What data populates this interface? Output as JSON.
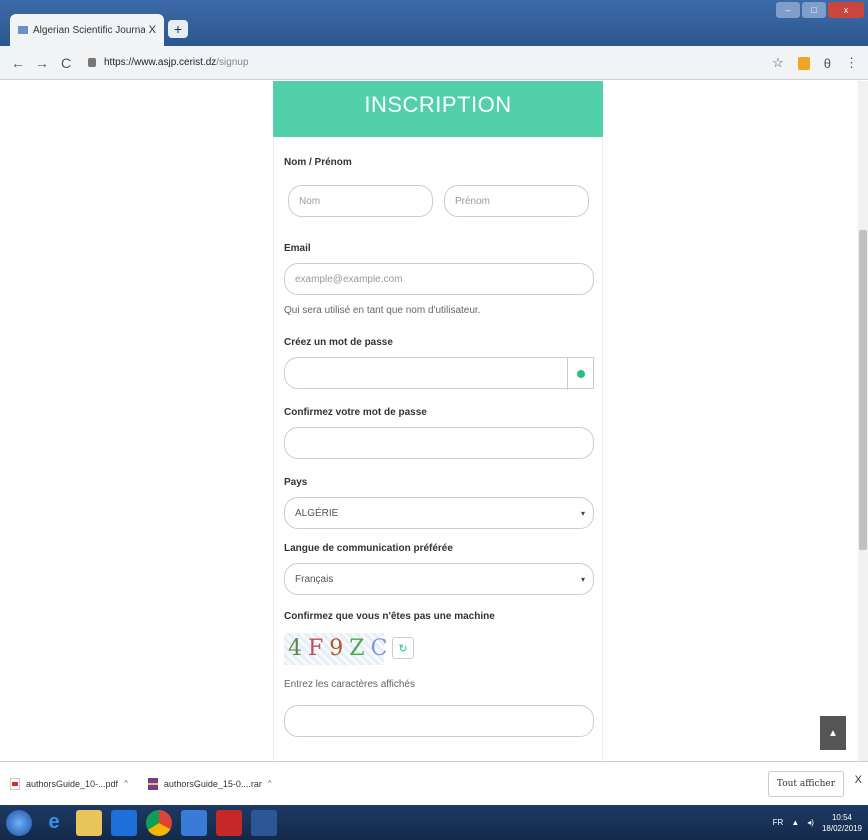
{
  "browser": {
    "tab_title": "Algerian Scientific Journal Platfo",
    "tab_favicon": "ASJP",
    "tab_close": "X",
    "new_tab": "+",
    "url_host": "https://www.asjp.cerist.dz",
    "url_path": "/signup",
    "back": "←",
    "forward": "→",
    "reload": "C",
    "star": "☆",
    "profile": "θ",
    "menu": "⋮"
  },
  "form": {
    "header": "INSCRIPTION",
    "name_label": "Nom / Prénom",
    "nom_placeholder": "Nom",
    "prenom_placeholder": "Prénom",
    "email_label": "Email",
    "email_placeholder": "example@example.com",
    "email_hint": "Qui sera utilisé en tant que nom d'utilisateur.",
    "password_label": "Créez un mot de passe",
    "confirm_label": "Confirmez votre mot de passe",
    "country_label": "Pays",
    "country_value": "ALGÉRIE",
    "language_label": "Langue de communication préférée",
    "language_value": "Français",
    "captcha_label": "Confirmez que vous n'êtes pas une machine",
    "captcha_chars": [
      "4",
      "F",
      "9",
      "Z",
      "C"
    ],
    "captcha_hint": "Entrez les caractères affichés",
    "select_arrow": "▾",
    "refresh_glyph": "↻"
  },
  "downloads": {
    "items": [
      {
        "name": "authorsGuide_10-...pdf",
        "icon": "pdf-file-icon"
      },
      {
        "name": "authorsGuide_15-0....rar",
        "icon": "rar-file-icon"
      }
    ],
    "caret": "^",
    "show_all": "Tout afficher",
    "close": "X"
  },
  "tray": {
    "lang": "FR",
    "time": "10:54",
    "date": "18/02/2019"
  },
  "colors": {
    "accent": "#52d0aa",
    "eye_icon": "#2cbf7f"
  }
}
